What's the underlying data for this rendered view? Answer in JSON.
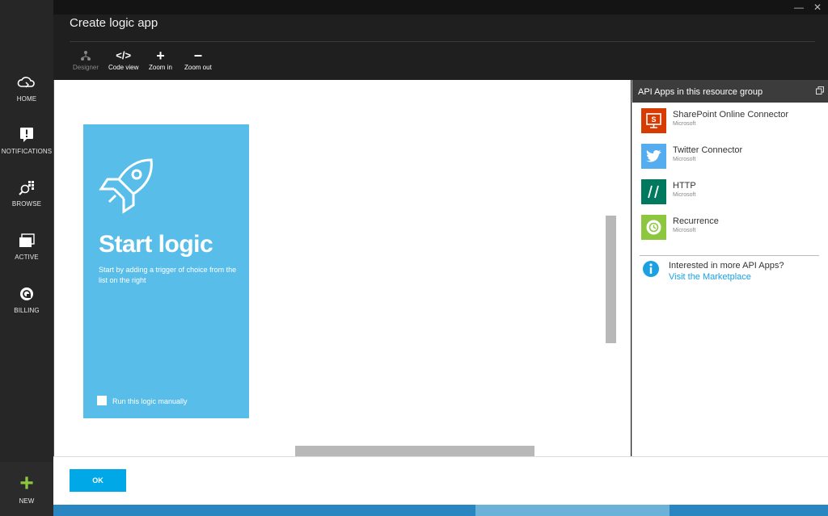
{
  "nav": {
    "home": "HOME",
    "notifications": "NOTIFICATIONS",
    "browse": "BROWSE",
    "active": "ACTIVE",
    "billing": "BILLING",
    "new": "NEW"
  },
  "header": {
    "title": "Create logic app",
    "window_minimize": "—",
    "window_close": "✕"
  },
  "toolbar": {
    "designer": "Designer",
    "code_view": "Code view",
    "zoom_in": "Zoom in",
    "zoom_out": "Zoom out"
  },
  "card": {
    "title": "Start logic",
    "subtitle": "Start by adding a trigger of choice from the list on the right",
    "checkbox_label": "Run this logic manually",
    "checkbox_checked": false
  },
  "panel": {
    "title": "API Apps in this resource group",
    "apps": [
      {
        "name": "SharePoint Online Connector",
        "publisher": "Microsoft",
        "icon": "sharepoint-icon",
        "color": "#d83b01"
      },
      {
        "name": "Twitter Connector",
        "publisher": "Microsoft",
        "icon": "twitter-icon",
        "color": "#55acee"
      },
      {
        "name": "HTTP",
        "publisher": "Microsoft",
        "icon": "http-icon",
        "color": "#00795f"
      },
      {
        "name": "Recurrence",
        "publisher": "Microsoft",
        "icon": "recurrence-icon",
        "color": "#8dc63f"
      }
    ],
    "more_question": "Interested in more API Apps?",
    "more_link": "Visit the Marketplace"
  },
  "footer": {
    "ok_label": "OK"
  },
  "colors": {
    "accent": "#00a8e8",
    "card": "#59bdea",
    "new_plus": "#8dc63f"
  }
}
